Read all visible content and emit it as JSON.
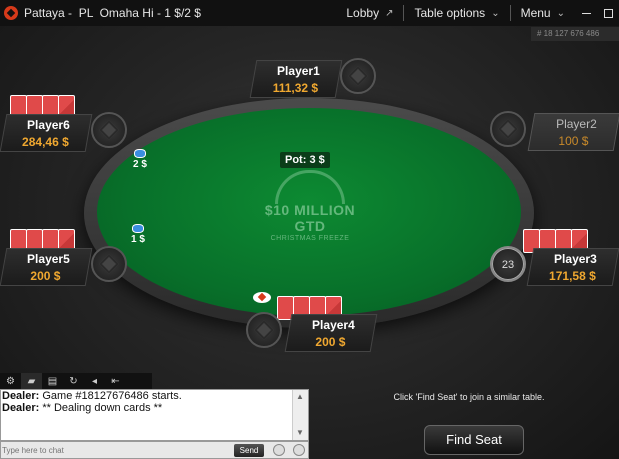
{
  "window": {
    "title": "Pattaya -  PL  Omaha Hi - 1 $/2 $",
    "lobby": "Lobby",
    "table_options": "Table options",
    "menu": "Menu",
    "game_id": "# 18 127 676 486"
  },
  "table": {
    "pot_label": "Pot:",
    "pot_value": "3 $",
    "felt_main": "$10 MILLION GTD",
    "felt_sub": "CHRISTMAS FREEZE"
  },
  "players": [
    {
      "name": "Player1",
      "stack": "111,32 $"
    },
    {
      "name": "Player2",
      "stack": "100 $"
    },
    {
      "name": "Player3",
      "stack": "171,58 $",
      "timer": "23"
    },
    {
      "name": "Player4",
      "stack": "200 $"
    },
    {
      "name": "Player5",
      "stack": "200 $"
    },
    {
      "name": "Player6",
      "stack": "284,46 $"
    }
  ],
  "bets": {
    "player6": "2 $",
    "player5": "1 $"
  },
  "chat": {
    "lines": [
      {
        "speaker": "Dealer:",
        "text": " Game #18127676486 starts."
      },
      {
        "speaker": "Dealer:",
        "text": " ** Dealing down cards **"
      }
    ],
    "placeholder": "Type here to chat",
    "send": "Send"
  },
  "footer": {
    "hint": "Click 'Find Seat' to join a similar table.",
    "find_seat": "Find Seat"
  },
  "icons": [
    "logo-icon",
    "external-link-icon",
    "chevron-down-icon",
    "minimize-icon",
    "maximize-icon",
    "gear-icon",
    "chat-icon",
    "notes-icon",
    "stats-icon",
    "sound-icon",
    "collapse-icon",
    "emoji-icon",
    "settings-icon",
    "dealer-button-icon",
    "chip-icon"
  ],
  "colors": {
    "felt": "#08702a",
    "stack_text": "#f0a830",
    "card_back": "#e04a4a",
    "brand": "#d63a1a"
  }
}
